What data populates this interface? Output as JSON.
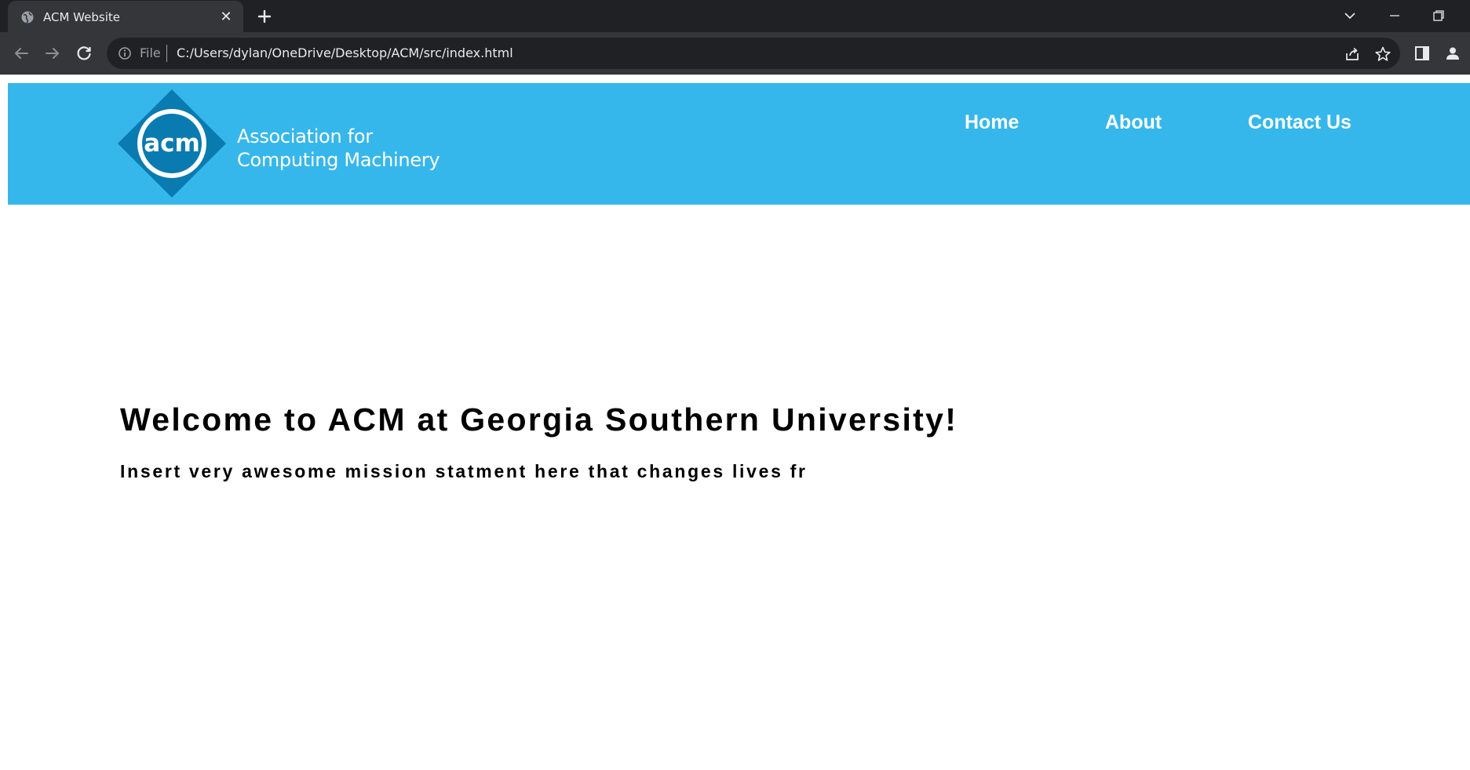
{
  "browser": {
    "tab": {
      "title": "ACM Website"
    },
    "address_bar": {
      "scheme_label": "File",
      "url": "C:/Users/dylan/OneDrive/Desktop/ACM/src/index.html"
    },
    "colors": {
      "frame": "#202124",
      "toolbar": "#35363a",
      "text": "#e8eaed"
    }
  },
  "site": {
    "header_color": "#36b7eb",
    "logo": {
      "mark_text": "acm",
      "line1": "Association for",
      "line2": "Computing Machinery"
    },
    "nav": [
      {
        "label": "Home"
      },
      {
        "label": "About"
      },
      {
        "label": "Contact Us"
      }
    ],
    "hero": {
      "title": "Welcome to ACM at Georgia Southern University!",
      "subtitle": "Insert very awesome mission statment here that changes lives fr"
    }
  }
}
